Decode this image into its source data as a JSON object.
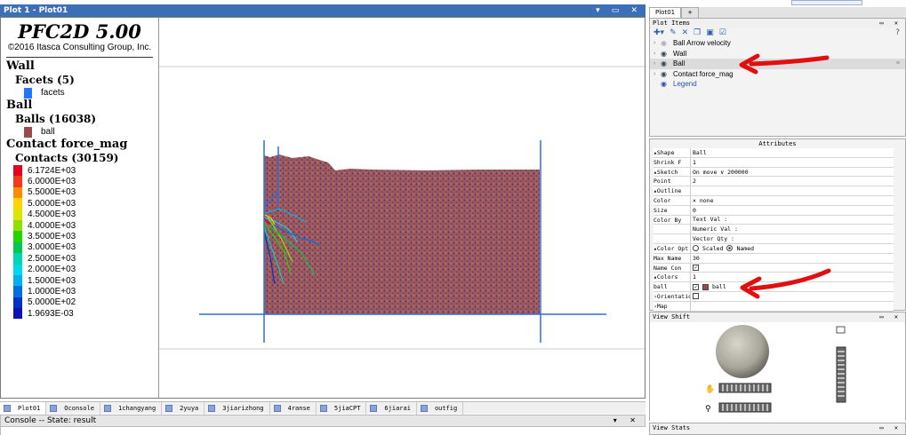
{
  "window": {
    "title": "Plot 1 - Plot01",
    "controls": "▾ ▭ ✕"
  },
  "legend": {
    "title": "PFC2D 5.00",
    "copyright": "©2016 Itasca Consulting Group, Inc.",
    "wall_group": "Wall",
    "facets_label": "Facets (5)",
    "facets_item": "facets",
    "facets_color": "#1f77ff",
    "ball_group": "Ball",
    "balls_label": "Balls (16038)",
    "ball_item": "ball",
    "ball_color": "#9b4b4b",
    "contact_group": "Contact force_mag",
    "contacts_label": "Contacts (30159)",
    "scale": [
      {
        "label": "6.1724E+03",
        "color": "#e8001c"
      },
      {
        "label": "6.0000E+03",
        "color": "#f23a1a"
      },
      {
        "label": "5.5000E+03",
        "color": "#ff8a00"
      },
      {
        "label": "5.0000E+03",
        "color": "#ffd400"
      },
      {
        "label": "4.5000E+03",
        "color": "#d8e600"
      },
      {
        "label": "4.0000E+03",
        "color": "#8fe000"
      },
      {
        "label": "3.5000E+03",
        "color": "#22d400"
      },
      {
        "label": "3.0000E+03",
        "color": "#00c850"
      },
      {
        "label": "2.5000E+03",
        "color": "#00d6b4"
      },
      {
        "label": "2.0000E+03",
        "color": "#00d8f0"
      },
      {
        "label": "1.5000E+03",
        "color": "#00b0f0"
      },
      {
        "label": "1.0000E+03",
        "color": "#0070e0"
      },
      {
        "label": "5.0000E+02",
        "color": "#0030c8"
      },
      {
        "label": "1.9693E-03",
        "color": "#1010b8"
      }
    ]
  },
  "tabs": [
    {
      "label": "Plot01",
      "active": true
    },
    {
      "label": "Oconsole"
    },
    {
      "label": "1changyang"
    },
    {
      "label": "2yuya"
    },
    {
      "label": "3jiarizhong"
    },
    {
      "label": "4ranse"
    },
    {
      "label": "5jiaCPT"
    },
    {
      "label": "6jiarai"
    },
    {
      "label": "outfig"
    }
  ],
  "console": {
    "title": "Console -- State: result",
    "controls": "▾ ✕"
  },
  "right_panel": {
    "tabs": [
      "Plot01",
      "+"
    ],
    "plot_items_title": "Plot Items",
    "plot_items_controls": "▭ ✕",
    "help": "?",
    "items": [
      {
        "label": "Ball Arrow velocity",
        "dim": true
      },
      {
        "label": "Wall"
      },
      {
        "label": "Ball",
        "selected": true
      },
      {
        "label": "Contact force_mag"
      },
      {
        "label": "Legend",
        "link": true
      }
    ],
    "attributes_title": "Attributes",
    "attributes": [
      {
        "k": "▴Shape",
        "v": "Ball",
        "dd": true
      },
      {
        "k": "  Shrink F",
        "v": "1"
      },
      {
        "k": " ▴Sketch",
        "v": "On move  ∨  200000"
      },
      {
        "k": "  Point",
        "v": "2"
      },
      {
        "k": " ▴Outline",
        "v": ""
      },
      {
        "k": "  Color",
        "v": "✕ none"
      },
      {
        "k": "  Size",
        "v": "0"
      },
      {
        "k": " Color By",
        "v": "Text Val  :"
      },
      {
        "k": "",
        "v": "Numeric Val :"
      },
      {
        "k": "",
        "v": "Vector Qty  :"
      },
      {
        "k": "▴Color Opt",
        "v": "radio"
      },
      {
        "k": "  Max Name",
        "v": "30"
      },
      {
        "k": "  Name Con",
        "v": "check"
      },
      {
        "k": " ▴Colors",
        "v": "1"
      },
      {
        "k": "  ball",
        "v": "swatch"
      },
      {
        "k": "›Orientatio",
        "v": "box"
      },
      {
        "k": "›Map",
        "v": ""
      }
    ],
    "color_opt_scaled": "Scaled",
    "color_opt_named": "Named",
    "swatch_label": "ball",
    "view_shift_title": "View Shift",
    "view_stats_title": "View Stats",
    "panel_controls": "▭ ✕"
  }
}
